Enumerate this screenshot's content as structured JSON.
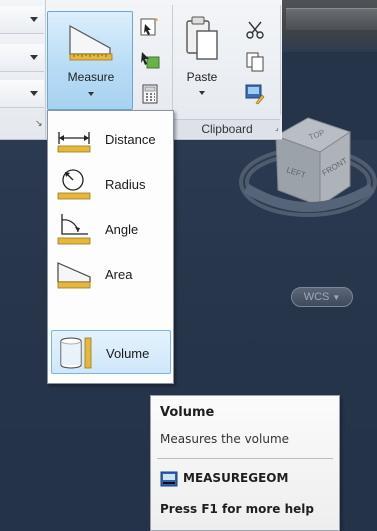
{
  "ribbon": {
    "measure_label": "Measure",
    "paste_label": "Paste",
    "clipboard_panel_label": "Clipboard",
    "panel_corner_glyph": "⌟"
  },
  "measure_menu": {
    "items": [
      {
        "label": "Distance",
        "icon": "distance-icon"
      },
      {
        "label": "Radius",
        "icon": "radius-icon"
      },
      {
        "label": "Angle",
        "icon": "angle-icon"
      },
      {
        "label": "Area",
        "icon": "area-icon"
      },
      {
        "label": "Volume",
        "icon": "volume-icon",
        "highlighted": true
      }
    ]
  },
  "tooltip": {
    "title": "Volume",
    "description": "Measures the volume",
    "command": "MEASUREGEOM",
    "help": "Press F1 for more help"
  },
  "viewcube": {
    "faces": {
      "top": "TOP",
      "left": "LEFT",
      "front": "FRONT"
    },
    "wcs_label": "WCS"
  },
  "colors": {
    "accent": "#6aa7d8",
    "canvas_bg": "#27354b",
    "ruler_yellow": "#e6b83a"
  }
}
